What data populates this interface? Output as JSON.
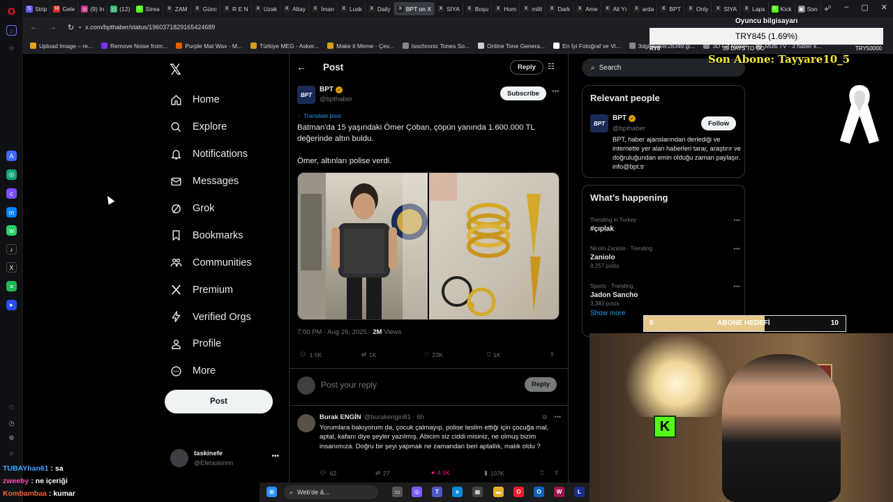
{
  "browser": {
    "tabs": [
      {
        "label": "Strip",
        "color": "#635bff",
        "icon": "S"
      },
      {
        "label": "Gele",
        "color": "#d93025",
        "icon": "M"
      },
      {
        "label": "(9) In",
        "color": "#c13584",
        "icon": "◎"
      },
      {
        "label": "(12)",
        "color": "#3cb371",
        "icon": "◻"
      },
      {
        "label": "Strea",
        "color": "#53fc18",
        "icon": "K"
      },
      {
        "label": "ZAM",
        "color": "#222",
        "icon": "X"
      },
      {
        "label": "Günc",
        "color": "#222",
        "icon": "X"
      },
      {
        "label": "R E N",
        "color": "#222",
        "icon": "X"
      },
      {
        "label": "Uzak",
        "color": "#222",
        "icon": "X"
      },
      {
        "label": "Altay",
        "color": "#222",
        "icon": "X"
      },
      {
        "label": "İman",
        "color": "#222",
        "icon": "X"
      },
      {
        "label": "Lusk",
        "color": "#222",
        "icon": "X"
      },
      {
        "label": "Daily",
        "color": "#222",
        "icon": "X"
      },
      {
        "label": "BPT on X",
        "color": "#222",
        "icon": "X",
        "active": true
      },
      {
        "label": "SİYA",
        "color": "#222",
        "icon": "X"
      },
      {
        "label": "Boşu",
        "color": "#222",
        "icon": "X"
      },
      {
        "label": "Hom",
        "color": "#222",
        "icon": "X"
      },
      {
        "label": "milit",
        "color": "#222",
        "icon": "X"
      },
      {
        "label": "Dark",
        "color": "#222",
        "icon": "X"
      },
      {
        "label": "Ame",
        "color": "#222",
        "icon": "X"
      },
      {
        "label": "Ali Yı",
        "color": "#222",
        "icon": "X"
      },
      {
        "label": "arda",
        "color": "#222",
        "icon": "X"
      },
      {
        "label": "BPT",
        "color": "#222",
        "icon": "X"
      },
      {
        "label": "Only",
        "color": "#222",
        "icon": "X"
      },
      {
        "label": "SİYA",
        "color": "#222",
        "icon": "X"
      },
      {
        "label": "Laps",
        "color": "#222",
        "icon": "X"
      },
      {
        "label": "Kick",
        "color": "#53fc18",
        "icon": "K"
      },
      {
        "label": "Son",
        "color": "#888",
        "icon": "▣"
      }
    ],
    "url": "x.com/bpthaber/status/1960371829165424689",
    "bookmarks": [
      {
        "label": "Upload Image – re...",
        "color": "#e8a317"
      },
      {
        "label": "Remove Noise from...",
        "color": "#7b2ff7"
      },
      {
        "label": "Purple Mat Wax - M...",
        "color": "#e65c00"
      },
      {
        "label": "Türkiye MEG - Asker...",
        "color": "#d4a017"
      },
      {
        "label": "Make it Meme - Çev...",
        "color": "#d4a017"
      },
      {
        "label": "Isochronic Tones So...",
        "color": "#888"
      },
      {
        "label": "Online Tone Genera...",
        "color": "#ccc"
      },
      {
        "label": "En İyi Fotoğraf ve Vi...",
        "color": "#fff"
      },
      {
        "label": "3dgifmaker28349.gi...",
        "color": "#888"
      },
      {
        "label": "3D Gif Maker",
        "color": "#888"
      },
      {
        "label": "Multi TV - 3 haber k...",
        "color": "#888"
      }
    ]
  },
  "nav": {
    "items": [
      {
        "label": "Home",
        "icon": "home-icon"
      },
      {
        "label": "Explore",
        "icon": "search-icon"
      },
      {
        "label": "Notifications",
        "icon": "bell-icon"
      },
      {
        "label": "Messages",
        "icon": "envelope-icon"
      },
      {
        "label": "Grok",
        "icon": "grok-icon"
      },
      {
        "label": "Bookmarks",
        "icon": "bookmark-icon"
      },
      {
        "label": "Communities",
        "icon": "people-icon"
      },
      {
        "label": "Premium",
        "icon": "x-icon"
      },
      {
        "label": "Verified Orgs",
        "icon": "lightning-icon"
      },
      {
        "label": "Profile",
        "icon": "person-icon"
      },
      {
        "label": "More",
        "icon": "more-circle-icon"
      }
    ],
    "post_label": "Post",
    "account_name": "taskinefe",
    "account_handle": "@Efetaskinnn"
  },
  "post": {
    "header_title": "Post",
    "reply_label": "Reply",
    "author_name": "BPT",
    "author_handle": "@bpthaber",
    "author_avatar_text": "BPT",
    "subscribe_label": "Subscribe",
    "translate_label": "Translate post",
    "text_1": "Batman'da 15 yaşındaki Ömer Çoban, çöpün yanında 1.600.000 TL değerinde altın buldu.",
    "text_2": "Ömer, altınları polise verdi.",
    "time": "7:00 PM · Aug 26, 2025 · ",
    "views_count": "2M",
    "views_label": " Views",
    "replies": "1.5K",
    "reposts": "1K",
    "likes": "23K",
    "bookmarks": "1K"
  },
  "compose": {
    "placeholder": "Post your reply",
    "reply_label": "Reply"
  },
  "reply": {
    "name": "Burak ENGİN",
    "handle": "@burakengin81 · 6h",
    "text": "Yorumlara bakıyorum da, çocuk çalmayıp, polise teslim ettiği için çocuğa mal, aptal, kafanı diye şeyler yazılmış. Abicim siz ciddi misiniz, ne olmuş bizim insanımıza. Doğru bir şeyi yapmak ne zamandan beri aptallık, malık oldu ?",
    "replies": "62",
    "reposts": "27",
    "likes": "4.5K",
    "views": "107K"
  },
  "sidebar": {
    "search_placeholder": "Search",
    "relevant_title": "Relevant people",
    "rp_name": "BPT",
    "rp_handle": "@bpthaber",
    "rp_avatar_text": "BPT",
    "rp_bio": "BPT, haber ajanslarından derlediği ve internette yer alan haberleri tarar, araştırır ve doğruluğundan emin olduğu zaman paylaşır. info@bpt.tr",
    "follow_label": "Follow",
    "happening_title": "What’s happening",
    "trends": [
      {
        "context": "Trending in Turkey",
        "name": "#çıplak",
        "posts": ""
      },
      {
        "context": "Nicolo Zaniolo · Trending",
        "name": "Zaniolo",
        "posts": "9,257 posts"
      },
      {
        "context": "Sports · Trending",
        "name": "Jadon Sancho",
        "posts": "3,383 posts"
      }
    ],
    "show_more": "Show more"
  },
  "overlay": {
    "oyuncu": "Oyuncu bilgisayarı",
    "try_value": "TRY845 (1.69%)",
    "try_left": "RY0",
    "days": "39 DAYS TO GO",
    "try_right": "TRY50000",
    "son_abone": "Son Abone: Tayyare10_5",
    "goal_left": "6",
    "goal_label": "ABONE HEDEFİ",
    "goal_right": "10",
    "goal_progress": 0.6,
    "kick_label": "K"
  },
  "chat": [
    {
      "user": "TUBAYhan61",
      "color": "#3da5ff",
      "message": "sa"
    },
    {
      "user": "zweeby",
      "color": "#ff4fb0",
      "message": "ne içeriği"
    },
    {
      "user": "Kombambaa",
      "color": "#ff5f3a",
      "message": "kumar"
    }
  ],
  "taskbar": {
    "search_label": "Web'de &..."
  }
}
